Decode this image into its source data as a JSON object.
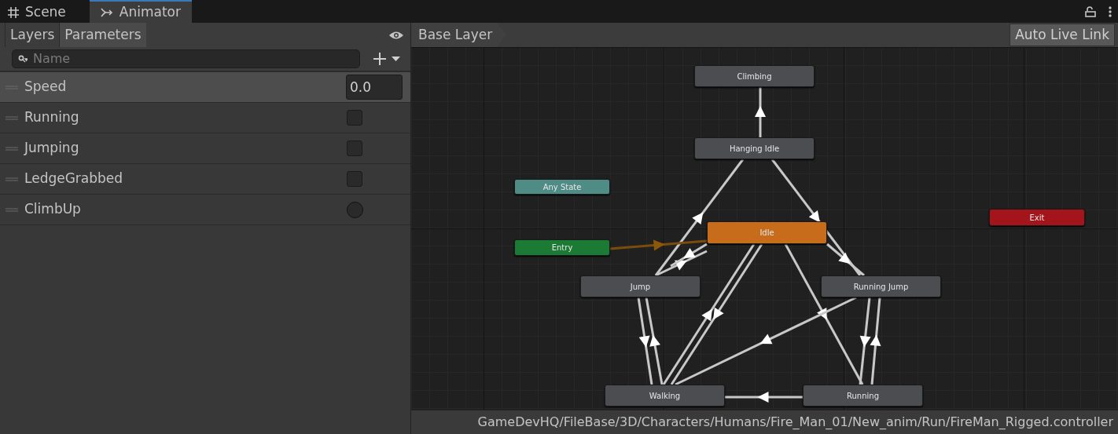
{
  "window_tabs": [
    {
      "label": "Scene",
      "kind": "scene",
      "selected": false
    },
    {
      "label": "Animator",
      "kind": "animator",
      "selected": true
    }
  ],
  "panel_tabs": [
    {
      "label": "Layers",
      "selected": false
    },
    {
      "label": "Parameters",
      "selected": true
    }
  ],
  "search": {
    "placeholder": "Name"
  },
  "parameters": [
    {
      "name": "Speed",
      "kind": "float",
      "value": "0.0",
      "selected": true
    },
    {
      "name": "Running",
      "kind": "bool",
      "checked": false,
      "selected": false
    },
    {
      "name": "Jumping",
      "kind": "bool",
      "checked": false,
      "selected": false
    },
    {
      "name": "LedgeGrabbed",
      "kind": "bool",
      "checked": false,
      "selected": false
    },
    {
      "name": "ClimbUp",
      "kind": "trigger",
      "checked": false,
      "selected": false
    }
  ],
  "breadcrumb": "Base Layer",
  "live_link_button": "Auto Live Link",
  "states": [
    {
      "label": "Climbing",
      "kind": "normal"
    },
    {
      "label": "Hanging Idle",
      "kind": "normal"
    },
    {
      "label": "Any State",
      "kind": "any"
    },
    {
      "label": "Exit",
      "kind": "exit"
    },
    {
      "label": "Idle",
      "kind": "default"
    },
    {
      "label": "Entry",
      "kind": "entry"
    },
    {
      "label": "Jump",
      "kind": "normal"
    },
    {
      "label": "Running Jump",
      "kind": "normal"
    },
    {
      "label": "Walking",
      "kind": "normal"
    },
    {
      "label": "Running",
      "kind": "normal"
    }
  ],
  "status_bar": "GameDevHQ/FileBase/3D/Characters/Humans/Fire_Man_01/New_anim/Run/FireMan_Rigged.controller"
}
